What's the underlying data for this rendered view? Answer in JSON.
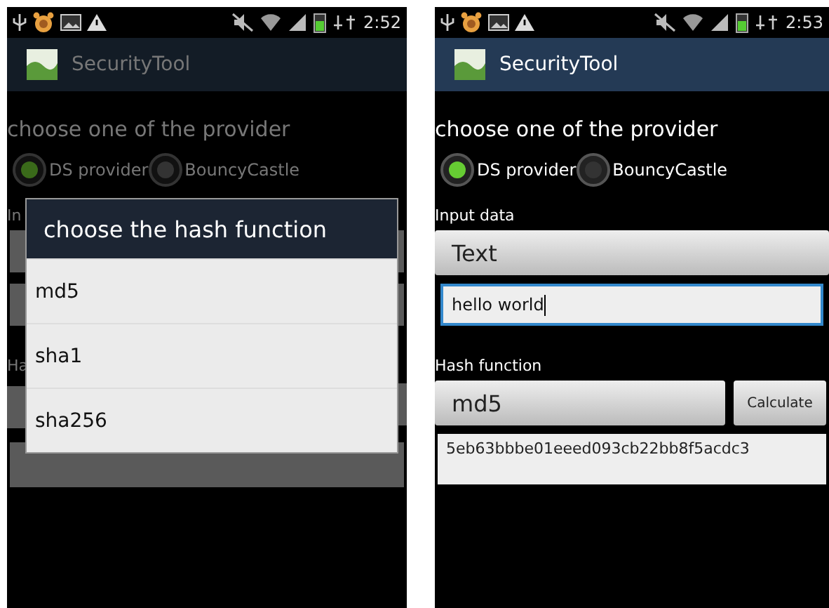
{
  "screens": [
    {
      "status_bar": {
        "time": "2:52"
      },
      "app_title": "SecurityTool",
      "provider_label": "choose one of the provider",
      "providers": [
        {
          "label": "DS provider",
          "selected": true
        },
        {
          "label": "BouncyCastle",
          "selected": false
        }
      ],
      "covered_labels": [
        "In",
        "Ha"
      ],
      "dialog": {
        "title": "choose the hash function",
        "options": [
          "md5",
          "sha1",
          "sha256"
        ]
      }
    },
    {
      "status_bar": {
        "time": "2:53"
      },
      "app_title": "SecurityTool",
      "provider_label": "choose one of the provider",
      "providers": [
        {
          "label": "DS provider",
          "selected": true
        },
        {
          "label": "BouncyCastle",
          "selected": false
        }
      ],
      "form": {
        "input_label": "Input data",
        "input_type": "Text",
        "input_value": "hello world",
        "hash_label": "Hash function",
        "hash_function": "md5",
        "calculate_button": "Calculate",
        "result": "5eb63bbbe01eeed093cb22bb8f5acdc3"
      }
    }
  ]
}
